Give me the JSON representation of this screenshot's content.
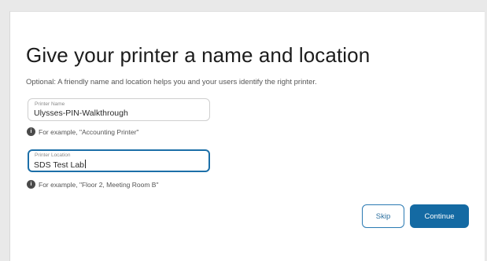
{
  "page": {
    "title": "Give your printer a name and location",
    "subtitle": "Optional: A friendly name and location helps you and your users identify the right printer."
  },
  "fields": {
    "name": {
      "label": "Printer Name",
      "value": "Ulysses-PIN-Walkthrough",
      "hint": "For example, \"Accounting Printer\""
    },
    "location": {
      "label": "Printer Location",
      "value": "SDS Test Lab",
      "hint": "For example, \"Floor 2, Meeting Room B\""
    }
  },
  "actions": {
    "skip_label": "Skip",
    "continue_label": "Continue"
  },
  "colors": {
    "accent": "#146aa3",
    "focus_border": "#1c6fa8",
    "info_icon": "#4a4a4a"
  },
  "icons": {
    "hint": "info-icon"
  }
}
